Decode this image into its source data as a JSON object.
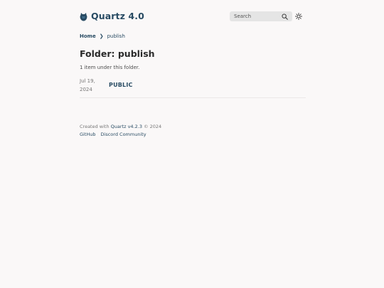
{
  "header": {
    "site_title": "Quartz 4.0",
    "search_placeholder": "Search",
    "icons": {
      "logo": "quartz-logo-icon",
      "search": "search-icon",
      "theme": "sun-icon"
    }
  },
  "breadcrumb": {
    "home": "Home",
    "separator": "❯",
    "current": "publish"
  },
  "main": {
    "title": "Folder: publish",
    "description": "1 item under this folder.",
    "items": [
      {
        "date": "Jul 19, 2024",
        "title": "PUBLIC"
      }
    ]
  },
  "footer": {
    "created_with": "Created with",
    "quartz_link": "Quartz v4.2.3",
    "copyright": "© 2024",
    "links": [
      "GitHub",
      "Discord Community"
    ]
  },
  "colors": {
    "background": "#faf8f8",
    "accent": "#284b63",
    "text": "#4e4e4e",
    "muted": "#777777",
    "search_bg": "#e5e5e5"
  }
}
